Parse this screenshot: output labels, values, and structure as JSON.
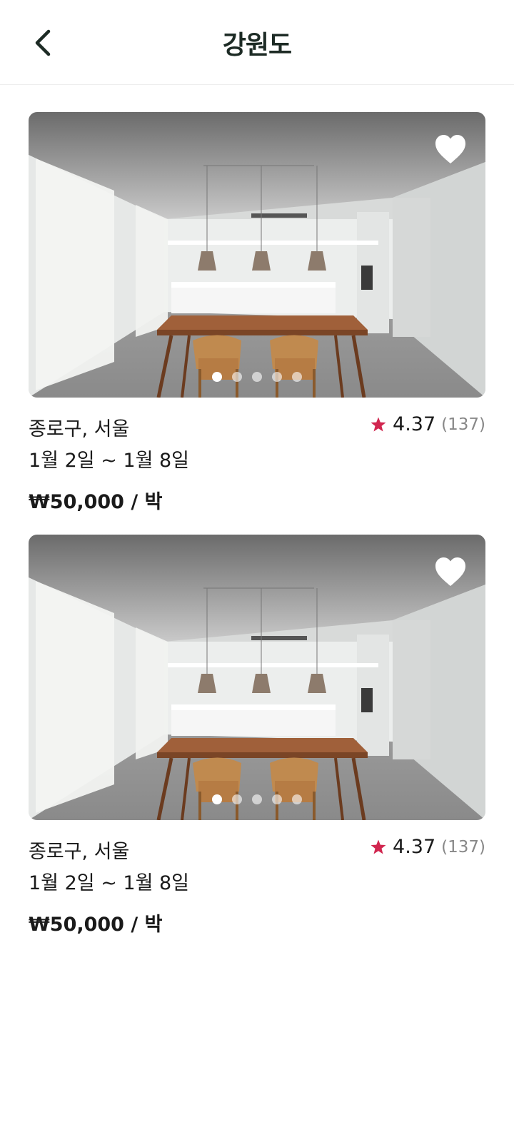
{
  "header": {
    "title": "강원도",
    "back_icon": "chevron-left-icon"
  },
  "listings": [
    {
      "location": "종로구, 서울",
      "dates": "1월 2일 ~ 1월 8일",
      "price": "₩50,000 / 박",
      "rating": "4.37",
      "reviews": "(137)",
      "favorited": true,
      "photo_count": 5,
      "active_photo": 1
    },
    {
      "location": "종로구, 서울",
      "dates": "1월 2일 ~ 1월 8일",
      "price": "₩50,000 / 박",
      "rating": "4.37",
      "reviews": "(137)",
      "favorited": true,
      "photo_count": 5,
      "active_photo": 1
    }
  ],
  "colors": {
    "star": "#d1264f",
    "title": "#1d2b25",
    "heart": "#ffffff"
  },
  "icons": {
    "favorite": "heart-icon",
    "rating": "star-icon"
  }
}
